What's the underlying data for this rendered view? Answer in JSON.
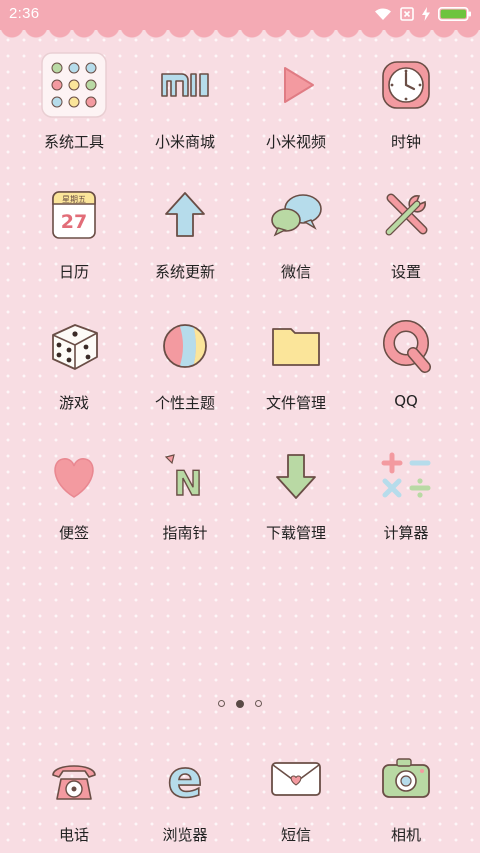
{
  "status_bar": {
    "time": "2:36",
    "battery_level": 1.0,
    "icons": [
      "wifi-icon",
      "sim-icon",
      "charging-icon",
      "battery-icon"
    ]
  },
  "apps": [
    {
      "label": "系统工具",
      "icon": "folder-icon"
    },
    {
      "label": "小米商城",
      "icon": "mi-logo-icon"
    },
    {
      "label": "小米视频",
      "icon": "play-icon"
    },
    {
      "label": "时钟",
      "icon": "clock-icon"
    },
    {
      "label": "日历",
      "icon": "calendar-icon",
      "calendar_day": "27",
      "calendar_weekday": "星期五"
    },
    {
      "label": "系统更新",
      "icon": "up-arrow-icon"
    },
    {
      "label": "微信",
      "icon": "chat-bubbles-icon"
    },
    {
      "label": "设置",
      "icon": "tools-icon"
    },
    {
      "label": "游戏",
      "icon": "dice-icon"
    },
    {
      "label": "个性主题",
      "icon": "ball-icon"
    },
    {
      "label": "文件管理",
      "icon": "file-icon"
    },
    {
      "label": "QQ",
      "icon": "qq-letter-icon"
    },
    {
      "label": "便签",
      "icon": "heart-icon"
    },
    {
      "label": "指南针",
      "icon": "compass-n-icon",
      "letter": "N"
    },
    {
      "label": "下载管理",
      "icon": "down-arrow-icon"
    },
    {
      "label": "计算器",
      "icon": "calculator-icon"
    }
  ],
  "page_indicator": {
    "count": 3,
    "current": 2
  },
  "dock": [
    {
      "label": "电话",
      "icon": "phone-icon"
    },
    {
      "label": "浏览器",
      "icon": "browser-icon",
      "letter": "e"
    },
    {
      "label": "短信",
      "icon": "envelope-icon"
    },
    {
      "label": "相机",
      "icon": "camera-icon"
    }
  ],
  "colors": {
    "background": "#f8dde3",
    "status_bar": "#f4aab4",
    "pink": "#f39aa0",
    "mint": "#b9d9a4",
    "sky": "#b6dceb",
    "yellow": "#fbe59a",
    "outline": "#6a4e46",
    "battery_green": "#6ec43e"
  }
}
